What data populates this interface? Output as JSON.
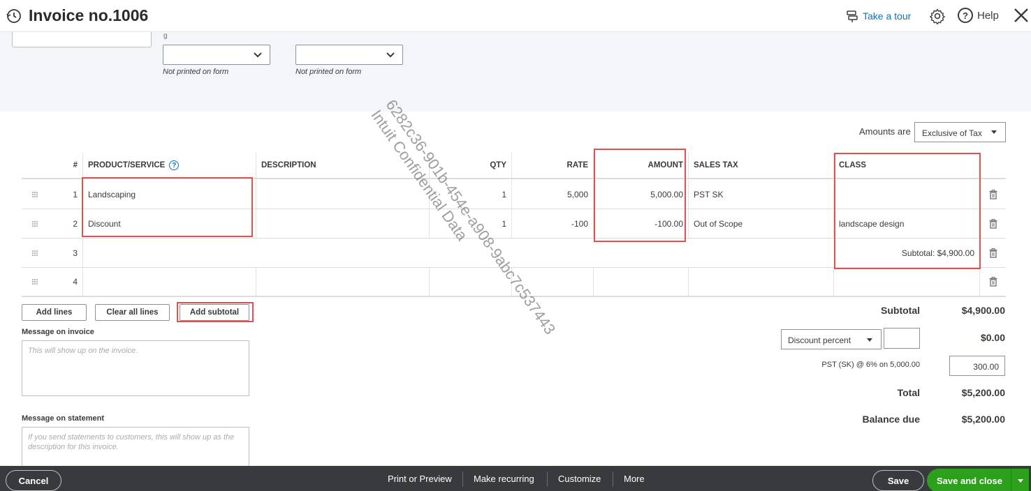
{
  "header": {
    "title": "Invoice no.1006",
    "take_tour": "Take a tour",
    "help": "Help"
  },
  "top": {
    "left_note": "Not printed on form",
    "right_note": "Not printed on form",
    "tiny_label": "g"
  },
  "amounts": {
    "label": "Amounts are",
    "value": "Exclusive of Tax"
  },
  "table": {
    "columns": {
      "num": "#",
      "product": "PRODUCT/SERVICE",
      "description": "DESCRIPTION",
      "qty": "QTY",
      "rate": "RATE",
      "amount": "AMOUNT",
      "sales_tax": "SALES TAX",
      "class": "CLASS"
    },
    "rows": [
      {
        "num": "1",
        "product": "Landscaping",
        "description": "",
        "qty": "1",
        "rate": "5,000",
        "amount": "5,000.00",
        "sales_tax": "PST SK",
        "class": ""
      },
      {
        "num": "2",
        "product": "Discount",
        "description": "",
        "qty": "1",
        "rate": "-100",
        "amount": "-100.00",
        "sales_tax": "Out of Scope",
        "class": "landscape design"
      },
      {
        "num": "3",
        "product": "",
        "description": "",
        "qty": "",
        "rate": "",
        "amount": "",
        "sales_tax": "",
        "class": "Subtotal: $4,900.00"
      },
      {
        "num": "4",
        "product": "",
        "description": "",
        "qty": "",
        "rate": "",
        "amount": "",
        "sales_tax": "",
        "class": ""
      }
    ]
  },
  "buttons": {
    "add_lines": "Add lines",
    "clear_all_lines": "Clear all lines",
    "add_subtotal": "Add subtotal"
  },
  "messages": {
    "invoice_label": "Message on invoice",
    "invoice_placeholder": "This will show up on the invoice.",
    "statement_label": "Message on statement",
    "statement_placeholder": "If you send statements to customers, this will show up as the description for this invoice."
  },
  "totals": {
    "subtotal_label": "Subtotal",
    "subtotal_value": "$4,900.00",
    "discount_type": "Discount percent",
    "discount_value": "$0.00",
    "pst_label": "PST (SK) @ 6% on 5,000.00",
    "pst_value": "300.00",
    "total_label": "Total",
    "total_value": "$5,200.00",
    "balance_label": "Balance due",
    "balance_value": "$5,200.00"
  },
  "watermark": {
    "line1": "6282c36-901b-454e-a908-9abc7c537443",
    "line2": "Intuit Confidential Data"
  },
  "footer": {
    "cancel": "Cancel",
    "print_preview": "Print or Preview",
    "make_recurring": "Make recurring",
    "customize": "Customize",
    "more": "More",
    "save": "Save",
    "save_and_close": "Save and close"
  },
  "colors": {
    "accent": "#0077c5",
    "primary_green": "#2ca01c",
    "highlight_red": "#e34e4e",
    "footer_bg": "#393a3d"
  }
}
